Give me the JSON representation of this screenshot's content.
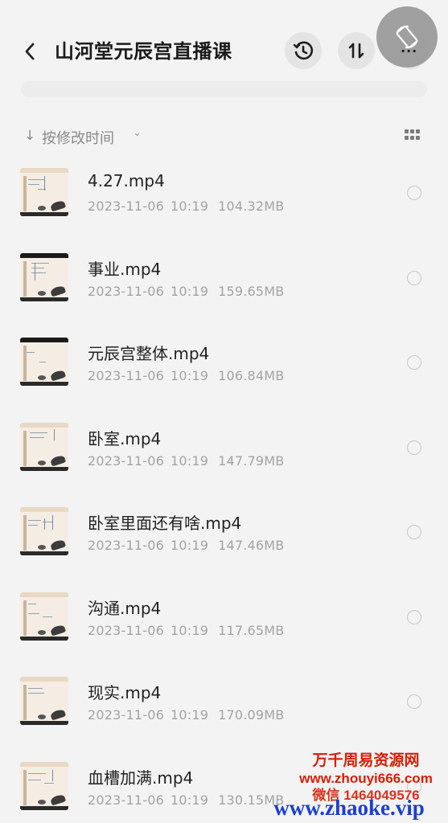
{
  "header": {
    "title": "山河堂元辰宫直播课",
    "more_label": "···"
  },
  "sort": {
    "arrow": "↓",
    "label": "按修改时间",
    "caret": "⌄"
  },
  "files": [
    {
      "name": "4.27.mp4",
      "date": "2023-11-06",
      "time": "10:19",
      "size": "104.32MB"
    },
    {
      "name": "事业.mp4",
      "date": "2023-11-06",
      "time": "10:19",
      "size": "159.65MB"
    },
    {
      "name": "元辰宫整体.mp4",
      "date": "2023-11-06",
      "time": "10:19",
      "size": "106.84MB"
    },
    {
      "name": "卧室.mp4",
      "date": "2023-11-06",
      "time": "10:19",
      "size": "147.79MB"
    },
    {
      "name": "卧室里面还有啥.mp4",
      "date": "2023-11-06",
      "time": "10:19",
      "size": "147.46MB"
    },
    {
      "name": "沟通.mp4",
      "date": "2023-11-06",
      "time": "10:19",
      "size": "117.65MB"
    },
    {
      "name": "现实.mp4",
      "date": "2023-11-06",
      "time": "10:19",
      "size": "170.09MB"
    },
    {
      "name": "血槽加满.mp4",
      "date": "2023-11-06",
      "time": "10:19",
      "size": "130.15MB"
    }
  ],
  "watermark": {
    "line1": "万千周易资源网",
    "line2": "www.zhouyi666.com",
    "line3": "微信 1464049576",
    "line4": "www.zhaoke.vip"
  },
  "icons": {
    "back": "chevron-left-icon",
    "history": "clock-icon",
    "sort": "sort-arrows-icon",
    "more": "more-dots-icon",
    "grid": "grid-view-icon",
    "float": "rotate-screen-icon"
  }
}
